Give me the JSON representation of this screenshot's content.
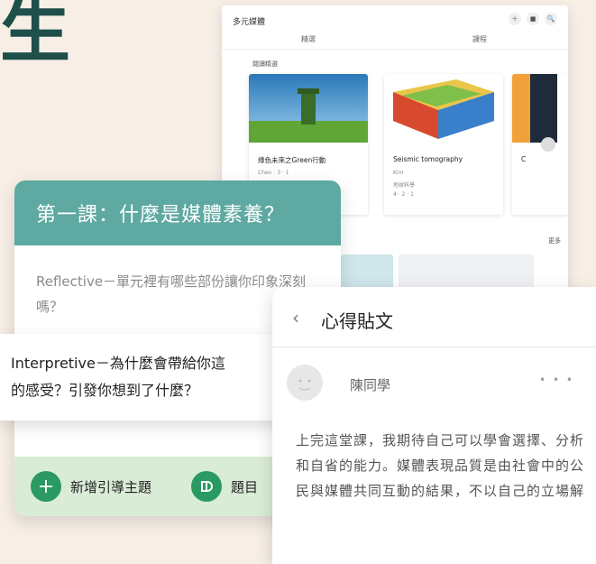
{
  "hero": {
    "partial_char": "生"
  },
  "window": {
    "title": "多元媒體",
    "tabs": [
      "精選",
      "課程"
    ],
    "section_label": "閱讀精選",
    "cards": [
      {
        "title": "綠色未來之Green行動",
        "meta": [
          "Chen · 3 · 1"
        ]
      },
      {
        "title": "Seismic tomography",
        "meta": [
          "Kim",
          "地球科學",
          "4 · 2 · 1"
        ]
      },
      {
        "title": "C",
        "meta": [
          "",
          "",
          ""
        ]
      }
    ],
    "see_all": "更多",
    "tool_icons": [
      "＋",
      "■",
      "🔍"
    ]
  },
  "lesson": {
    "title": "第一課：什麼是媒體素養？",
    "reflective_question": "Reflective－單元裡有哪些部份讓你印象深刻嗎？",
    "add_topic_label": "新增引導主題",
    "question_bank_label": "題目"
  },
  "interpretive": {
    "text_line1": "Interpretive－為什麼會帶給你這",
    "text_line2": "的感受？引發你想到了什麼？"
  },
  "post": {
    "title": "心得貼文",
    "author": "陳同學",
    "body": "上完這堂課，我期待自己可以學會選擇、分析和自省的能力。媒體表現品質是由社會中的公民與媒體共同互動的結果，不以自己的立場解"
  },
  "colors": {
    "teal_header": "#5ea9a1",
    "green_button": "#2a9a62",
    "footer_bg": "#d9ecd6",
    "page_bg": "#f7efe6",
    "hero_text": "#1f4f4a"
  }
}
